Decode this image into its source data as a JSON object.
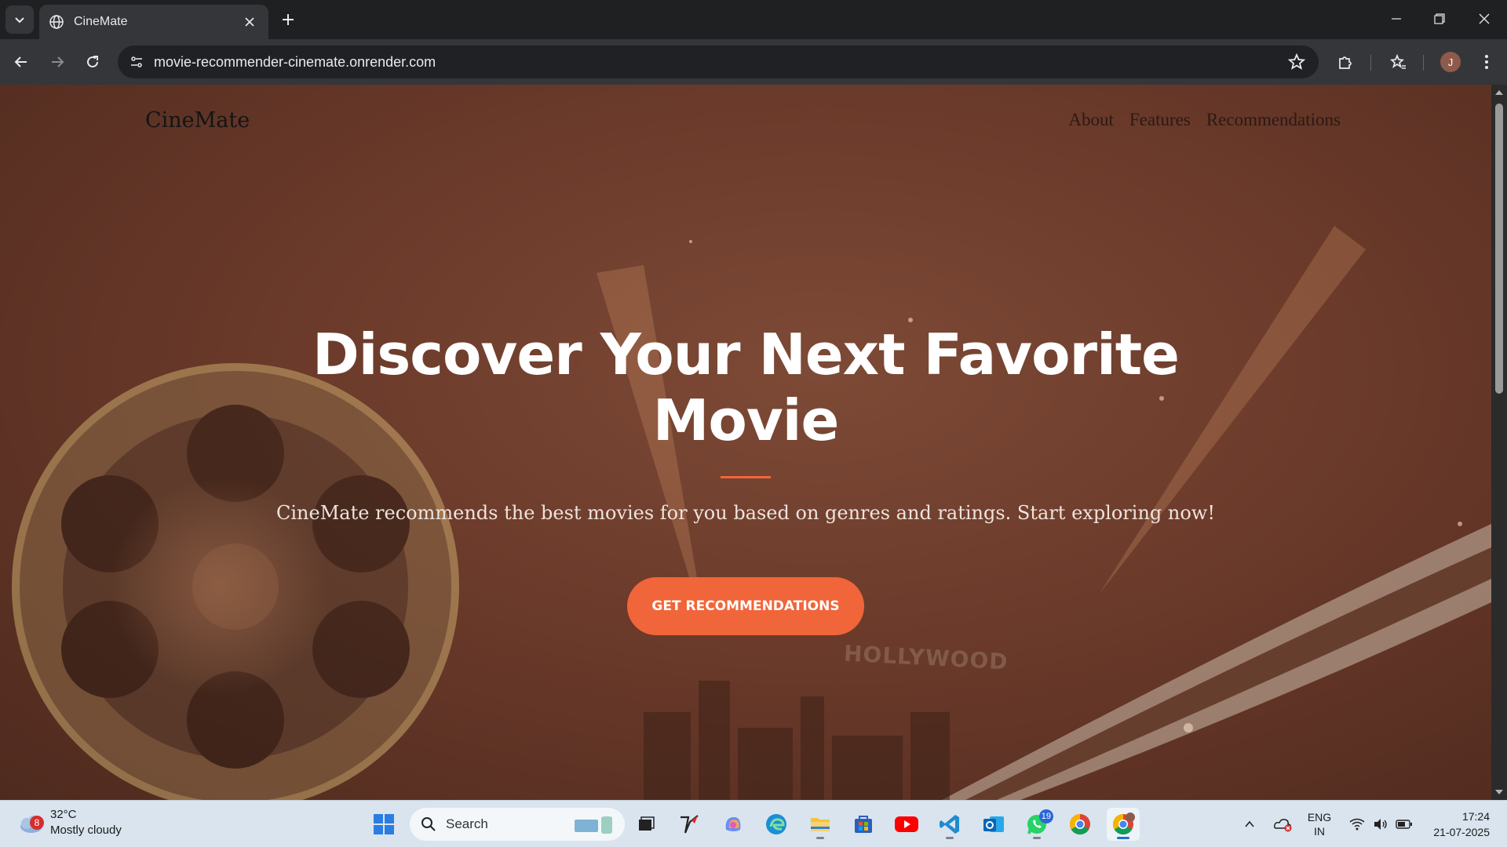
{
  "browser": {
    "tab_title": "CineMate",
    "url": "movie-recommender-cinemate.onrender.com",
    "profile_initial": "J"
  },
  "site": {
    "logo": "CineMate",
    "nav": [
      "About",
      "Features",
      "Recommendations"
    ],
    "hero_title_line1": "Discover Your Next Favorite",
    "hero_title_line2": "Movie",
    "hero_subtitle": "CineMate recommends the best movies for you based on genres and ratings. Start exploring now!",
    "cta_label": "GET RECOMMENDATIONS",
    "background_text": "HOLLYWOOD",
    "accent_color": "#f1653a"
  },
  "taskbar": {
    "weather_temp": "32°C",
    "weather_desc": "Mostly cloudy",
    "weather_badge": "8",
    "search_label": "Search",
    "whatsapp_badge": "19",
    "lang_line1": "ENG",
    "lang_line2": "IN",
    "time": "17:24",
    "date": "21-07-2025",
    "apps": [
      "windows-start",
      "search",
      "task-view",
      "tool-app",
      "copilot",
      "edge",
      "file-explorer",
      "microsoft-store",
      "youtube",
      "vscode",
      "outlook",
      "whatsapp",
      "chrome",
      "chrome-profile"
    ]
  }
}
